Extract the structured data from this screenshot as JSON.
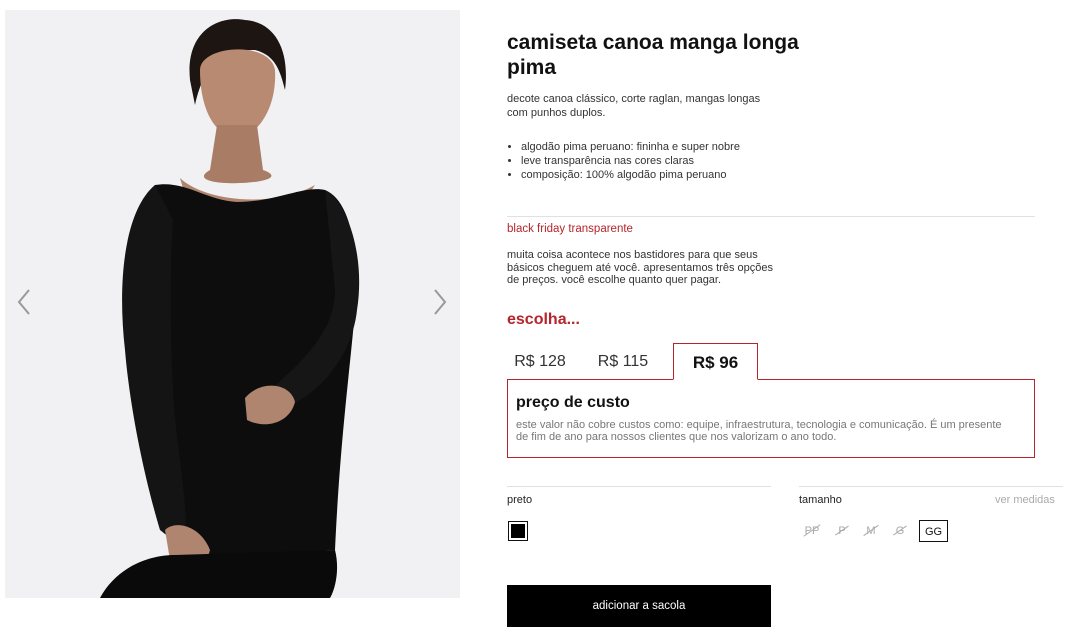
{
  "product": {
    "title": "camiseta canoa manga longa pima",
    "description": "decote canoa clássico, corte raglan, mangas longas com punhos duplos.",
    "features": [
      "algodão pima peruano: fininha e super nobre",
      "leve transparência nas cores claras",
      "composição: 100% algodão pima peruano"
    ]
  },
  "gallery": {
    "prev_icon": "chevron-left-icon",
    "next_icon": "chevron-right-icon"
  },
  "black_friday": {
    "title": "black friday transparente",
    "description": "muita coisa acontece nos bastidores para que seus básicos cheguem até você. apresentamos três opções de preços. você escolhe quanto quer pagar.",
    "choose_label": "escolha...",
    "prices": [
      {
        "label": "R$ 128",
        "selected": false
      },
      {
        "label": "R$ 115",
        "selected": false
      },
      {
        "label": "R$ 96",
        "selected": true
      }
    ],
    "panel": {
      "title": "preço de custo",
      "text": "este valor não cobre custos como: equipe, infraestrutura, tecnologia e comunicação. É um presente de fim de ano para nossos clientes que nos valorizam o ano todo."
    }
  },
  "color": {
    "label": "preto",
    "swatch_color": "#000000"
  },
  "size": {
    "label": "tamanho",
    "measures_link": "ver medidas",
    "options": [
      {
        "label": "PP",
        "available": false
      },
      {
        "label": "P",
        "available": false
      },
      {
        "label": "M",
        "available": false
      },
      {
        "label": "G",
        "available": false
      },
      {
        "label": "GG",
        "available": true,
        "selected": true
      }
    ]
  },
  "cart": {
    "add_label": "adicionar a sacola"
  },
  "colors": {
    "accent": "#b5252b",
    "button_bg": "#000000"
  }
}
